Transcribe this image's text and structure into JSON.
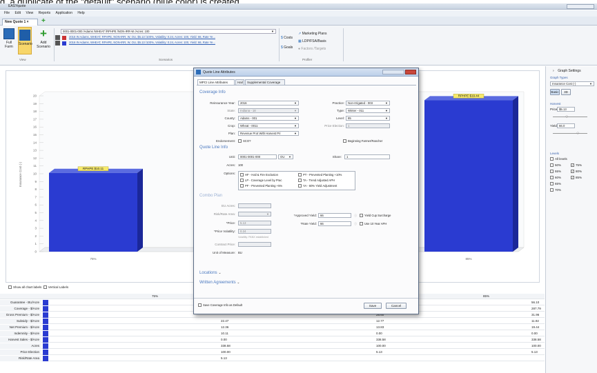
{
  "caption": "d, a duplicate of the \"default\" scenario (blue color) is created",
  "app": {
    "title": "EASYquote"
  },
  "menu": [
    "File",
    "Edit",
    "View",
    "Reports",
    "Application",
    "Help"
  ],
  "doc_tab": "New Quote 1 ×",
  "ribbon": {
    "buttons": {
      "full_farm": "Full\nFarm",
      "scenario": "Scenario",
      "add": "Add\nScenario"
    },
    "groups": {
      "view": "View",
      "scenarios": "Scenarios",
      "profiler": "Profiler"
    },
    "selector": "0001-0001-000 /Adams /WHEAT /RPHPE /NON-IRR-W /Acres: 100",
    "scenario_links": [
      "2016 IN Adams, WHEAT, RPHPE, NON-IRR, W, OU, $5.13 /100%, Volatility: 0.24, Acres: 100, Yield: 66, Rate Ye...",
      "2016 IN Adams, WHEAT, RPHPE, NON-IRR, W, OU, $5.13 /100%, Volatility: 0.24, Acres: 100, Yield: 66, Rate Ye..."
    ],
    "tools": {
      "costs": "Costs",
      "goals": "Goals",
      "marketing": "Marketing Plans",
      "ldp": "LDP/FSA/Basis",
      "factors": "Factors /Targets"
    }
  },
  "chart": {
    "y_ticks": [
      "20",
      "19",
      "18",
      "17",
      "16",
      "15",
      "14",
      "13",
      "12",
      "11",
      "10",
      "9",
      "8",
      "7",
      "6",
      "5",
      "4",
      "3",
      "2",
      "1",
      "0"
    ],
    "ylabel": "Insurance Cost (-)",
    "bars": [
      {
        "label": "RPHPE $10.11",
        "x_label": "75%"
      },
      {
        "label": "RPHPE $19.44",
        "x_label": "85%"
      }
    ],
    "bar_color": "#2a3bd1"
  },
  "chart_options": {
    "show_labels": "Show all chart labels",
    "vertical": "Vertical Labels"
  },
  "grid": {
    "columns": [
      "75%",
      "",
      "85%"
    ],
    "rows": [
      {
        "label": "Guarantee - BU/Acre",
        "v1": "",
        "v2": "",
        "v3": "56.10"
      },
      {
        "label": "Coverage - $/Acre",
        "v1": "",
        "v2": "",
        "v3": "287.79"
      },
      {
        "label": "Gross Premium - $/Acre",
        "v1": "",
        "v2": "28.60",
        "v3": "31.96"
      },
      {
        "label": "Subsidy - $/Acre",
        "v1": "22.47",
        "v2": "12.77",
        "v3": "11.92"
      },
      {
        "label": "Net Premium - $/Acre",
        "v1": "12.36",
        "v2": "13.83",
        "v3": "19.44"
      },
      {
        "label": "Indemnity - $/Acre",
        "v1": "10.11",
        "v2": "0.00",
        "v3": "0.00"
      },
      {
        "label": "Harvest Sales - $/Acre",
        "v1": "0.00",
        "v2": "338.58",
        "v3": "338.58"
      },
      {
        "label": "Acres",
        "v1": "338.58",
        "v2": "100.00",
        "v3": "100.00"
      },
      {
        "label": "Price Election",
        "v1": "100.00",
        "v2": "5.13",
        "v3": "5.13"
      },
      {
        "label": "Risk/Rate Area",
        "v1": "5.13",
        "v2": "",
        "v3": ""
      }
    ]
  },
  "side": {
    "header": "Graph Settings",
    "graph_types": "Graph Types",
    "graph_type_value": "Insurance Cost (-)",
    "basic": "Basic",
    "three_d": "3D",
    "harvest": "Harvest",
    "price_label": "Price:",
    "price_value": "$5.13",
    "yield_label": "Yield:",
    "yield_value": "66.0",
    "levels": "Levels",
    "all_levels": "All levels",
    "level_items": [
      "50%",
      "55%",
      "60%",
      "65%",
      "70%",
      "75%",
      "80%",
      "85%"
    ]
  },
  "dialog": {
    "title": "Quote Line Attributes",
    "tabs": [
      "MPCI Line Attributes",
      "Hail",
      "Supplemental Coverage"
    ],
    "coverage_info": "Coverage Info",
    "reinsurance_year_label": "Reinsurance Year:",
    "reinsurance_year": "2016",
    "state_label": "State:",
    "state": "Indiana - 18",
    "county_label": "County:",
    "county": "Adams - 001",
    "crop_label": "Crop:",
    "crop": "Wheat - 0011",
    "plan_label": "Plan:",
    "plan": "Revenue Prot With Harvest Pri",
    "endorsement_label": "Endorsement:",
    "endorsement": "SCO?",
    "practice_label": "Practice:",
    "practice": "Non-Irrigated - 003",
    "type_label": "Type:",
    "type": "Winter - 011",
    "level_label": "Level:",
    "level": "85",
    "price_election_label": "Price Election:",
    "price_election": "1",
    "beginning_farmer": "Beginning Farmer/Rancher",
    "quote_line_info": "Quote Line Info",
    "unit_label": "Unit:",
    "unit": "0001-0001-000",
    "unit_type": "OU",
    "share_label": "Share:",
    "share": "1",
    "acres_label": "Acres:",
    "acres": "100",
    "options_label": "Options:",
    "options_left": [
      "HF - Hail & Fire Exclusion",
      "LP - Coverage Level by Prac",
      "PF - Prevented Planting +5%"
    ],
    "options_right": [
      "PT - Prevented Planting +10%",
      "TA - Trend Adjusted APH",
      "YA - 60% Yield Adjustment"
    ],
    "combo_plan": "Combo Plan",
    "eu_acres_label": "EU Acres:",
    "risk_rate_label": "Risk/Rate Area:",
    "price_label": "*Price:",
    "price": "5.13",
    "volatility_label": "*Price Volatility:",
    "volatility": "0.24",
    "volatility_note": "Volatility: PANX established",
    "contract_price_label": "Contract Price:",
    "unit_measure_label": "Unit of Measure:",
    "unit_measure": "BU",
    "approved_yield_label": "*Approved Yield:",
    "approved_yield": "66",
    "rate_yield_label": "*Rate Yield:",
    "rate_yield": "66",
    "yield_cup": "Yield Cup Surcharge",
    "use_10_year": "Use 10 Year APH",
    "locations": "Locations",
    "written_agreements": "Written Agreements",
    "save_default": "Save Coverage Info as Default",
    "save": "Save",
    "cancel": "Cancel"
  }
}
